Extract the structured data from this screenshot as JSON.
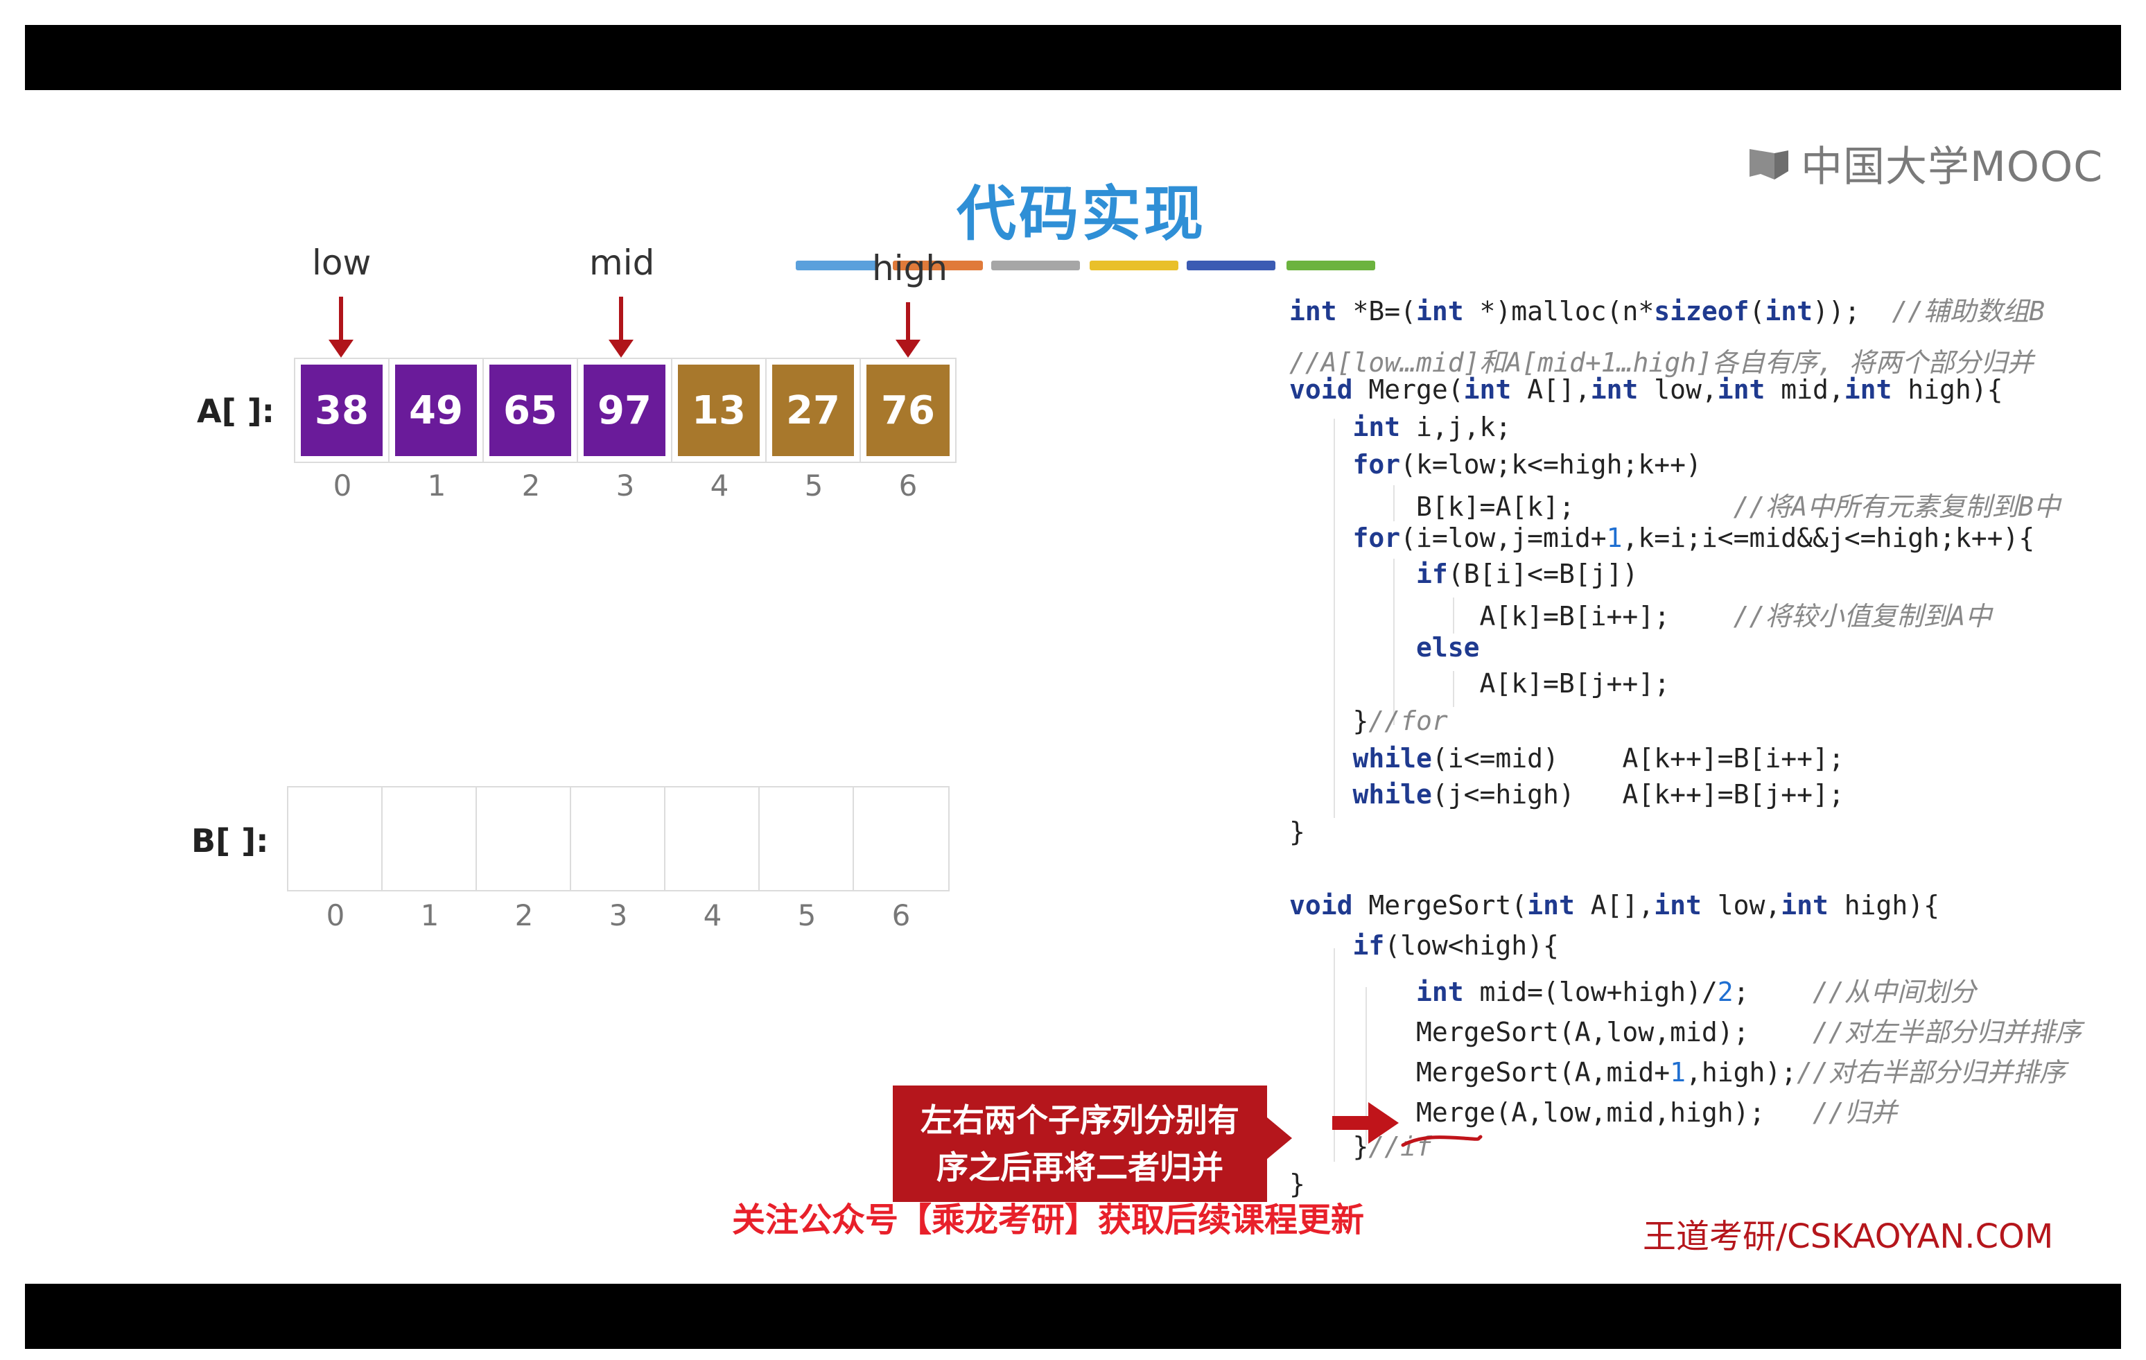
{
  "title": "代码实现",
  "logo": {
    "text": "中国大学MOOC",
    "icon": "mooc-logo-icon"
  },
  "pointers": {
    "low": "low",
    "mid": "mid",
    "high": "high"
  },
  "array_a": {
    "label": "A[ ]:",
    "values": [
      "38",
      "49",
      "65",
      "97",
      "13",
      "27",
      "76"
    ],
    "colors": [
      "purple",
      "purple",
      "purple",
      "purple",
      "gold",
      "gold",
      "gold"
    ],
    "indices": [
      "0",
      "1",
      "2",
      "3",
      "4",
      "5",
      "6"
    ]
  },
  "array_b": {
    "label": "B[ ]:",
    "values": [
      "",
      "",
      "",
      "",
      "",
      "",
      ""
    ],
    "indices": [
      "0",
      "1",
      "2",
      "3",
      "4",
      "5",
      "6"
    ]
  },
  "color_strip": [
    "#5aa0dc",
    "#e07a3a",
    "#a6a6a6",
    "#e9c02a",
    "#3b5bb3",
    "#6cb33f"
  ],
  "code": [
    [
      [
        "kw",
        "int"
      ],
      [
        "t",
        " *B=("
      ],
      [
        "kw",
        "int"
      ],
      [
        "t",
        " *)malloc(n*"
      ],
      [
        "kw",
        "sizeof"
      ],
      [
        "t",
        "("
      ],
      [
        "kw",
        "int"
      ],
      [
        "t",
        "));  "
      ],
      [
        "cm",
        "//辅助数组B"
      ]
    ],
    [
      [
        "cm",
        "//A[low…mid]和A[mid+1…high]各自有序, 将两个部分归并"
      ]
    ],
    [
      [
        "kw",
        "void"
      ],
      [
        "t",
        " Merge("
      ],
      [
        "kw",
        "int"
      ],
      [
        "t",
        " A[],"
      ],
      [
        "kw",
        "int"
      ],
      [
        "t",
        " low,"
      ],
      [
        "kw",
        "int"
      ],
      [
        "t",
        " mid,"
      ],
      [
        "kw",
        "int"
      ],
      [
        "t",
        " high){"
      ]
    ],
    [
      [
        "t",
        "    "
      ],
      [
        "kw",
        "int"
      ],
      [
        "t",
        " i,j,k;"
      ]
    ],
    [
      [
        "t",
        "    "
      ],
      [
        "kw",
        "for"
      ],
      [
        "t",
        "(k=low;k<=high;k++)"
      ]
    ],
    [
      [
        "t",
        "        B[k]=A[k];          "
      ],
      [
        "cm",
        "//将A中所有元素复制到B中"
      ]
    ],
    [
      [
        "t",
        "    "
      ],
      [
        "kw",
        "for"
      ],
      [
        "t",
        "(i=low,j=mid+"
      ],
      [
        "num",
        "1"
      ],
      [
        "t",
        ",k=i;i<=mid&&j<=high;k++){"
      ]
    ],
    [
      [
        "t",
        "        "
      ],
      [
        "kw",
        "if"
      ],
      [
        "t",
        "(B[i]<=B[j])"
      ]
    ],
    [
      [
        "t",
        "            A[k]=B[i++];    "
      ],
      [
        "cm",
        "//将较小值复制到A中"
      ]
    ],
    [
      [
        "t",
        "        "
      ],
      [
        "kw",
        "else"
      ]
    ],
    [
      [
        "t",
        "            A[k]=B[j++];"
      ]
    ],
    [
      [
        "t",
        "    }"
      ],
      [
        "cm",
        "//for"
      ]
    ],
    [
      [
        "t",
        "    "
      ],
      [
        "kw",
        "while"
      ],
      [
        "t",
        "(i<=mid)    A[k++]=B[i++];"
      ]
    ],
    [
      [
        "t",
        "    "
      ],
      [
        "kw",
        "while"
      ],
      [
        "t",
        "(j<=high)   A[k++]=B[j++];"
      ]
    ],
    [
      [
        "t",
        "}"
      ]
    ],
    [
      [
        "t",
        ""
      ]
    ],
    [
      [
        "kw",
        "void"
      ],
      [
        "t",
        " MergeSort("
      ],
      [
        "kw",
        "int"
      ],
      [
        "t",
        " A[],"
      ],
      [
        "kw",
        "int"
      ],
      [
        "t",
        " low,"
      ],
      [
        "kw",
        "int"
      ],
      [
        "t",
        " high){"
      ]
    ],
    [
      [
        "t",
        "    "
      ],
      [
        "kw",
        "if"
      ],
      [
        "t",
        "(low<high){"
      ]
    ],
    [
      [
        "t",
        "        "
      ],
      [
        "kw",
        "int"
      ],
      [
        "t",
        " mid=(low+high)/"
      ],
      [
        "num",
        "2"
      ],
      [
        "t",
        ";    "
      ],
      [
        "cm",
        "//从中间划分"
      ]
    ],
    [
      [
        "t",
        "        MergeSort(A,low,mid);    "
      ],
      [
        "cm",
        "//对左半部分归并排序"
      ]
    ],
    [
      [
        "t",
        "        MergeSort(A,mid+"
      ],
      [
        "num",
        "1"
      ],
      [
        "t",
        ",high);"
      ],
      [
        "cm",
        "//对右半部分归并排序"
      ]
    ],
    [
      [
        "t",
        "        Merge(A,low,mid,high);   "
      ],
      [
        "cm",
        "//归并"
      ]
    ],
    [
      [
        "t",
        "    }"
      ],
      [
        "cm",
        "//if"
      ]
    ],
    [
      [
        "t",
        "}"
      ]
    ]
  ],
  "callout": {
    "line1": "左右两个子序列分别有",
    "line2": "序之后再将二者归并"
  },
  "promo": "关注公众号【乘龙考研】获取后续课程更新",
  "brand": "王道考研/CSKAOYAN.COM"
}
